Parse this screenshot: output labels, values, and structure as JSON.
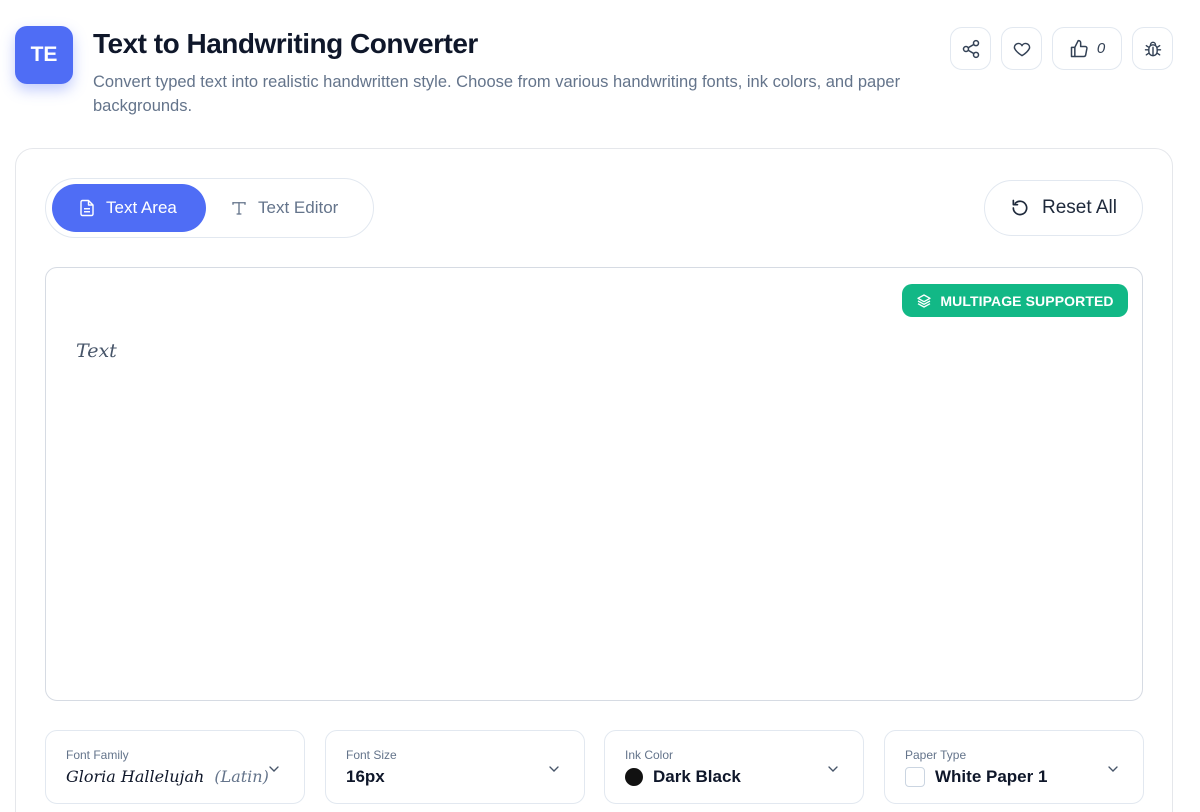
{
  "header": {
    "logo_text": "TE",
    "title": "Text to Handwriting Converter",
    "description": "Convert typed text into realistic handwritten style. Choose from various handwriting fonts, ink colors, and paper backgrounds.",
    "like_count": "0",
    "icons": [
      "share-icon",
      "heart-icon",
      "thumbs-up-icon",
      "bug-icon"
    ]
  },
  "tabs": [
    {
      "label": "Text Area",
      "icon": "document-icon",
      "active": true
    },
    {
      "label": "Text Editor",
      "icon": "text-icon",
      "active": false
    }
  ],
  "reset_label": "Reset All",
  "editor": {
    "badge": "MULTIPAGE SUPPORTED",
    "placeholder": "Text"
  },
  "controls": {
    "font_family": {
      "label": "Font Family",
      "value": "Gloria Hallelujah",
      "suffix": "(Latin)"
    },
    "font_size": {
      "label": "Font Size",
      "value": "16px"
    },
    "ink_color": {
      "label": "Ink Color",
      "value": "Dark Black",
      "swatch": "#111111"
    },
    "paper_type": {
      "label": "Paper Type",
      "value": "White Paper 1"
    }
  },
  "colors": {
    "accent": "#4f6df5",
    "badge": "#12b886"
  }
}
